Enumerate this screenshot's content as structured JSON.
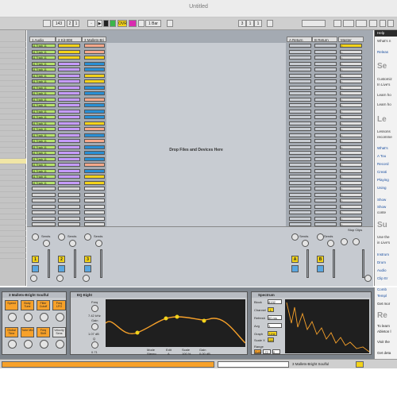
{
  "window": {
    "title": "Untitled"
  },
  "toolbar": {
    "tempo": "143",
    "sig_num": "2",
    "sig_den": "1",
    "ovr": "OVR",
    "quantize": "1 Bar",
    "pos_bars": "3",
    "pos_beats": "1",
    "pos_sixteenths": "1"
  },
  "tracks": [
    {
      "name": "1 Audio",
      "color": "#e0e0e0"
    },
    {
      "name": "2 Kit-808",
      "color": "#e0e0e0"
    },
    {
      "name": "3 Mallets-Bri",
      "color": "#e0e0e0"
    }
  ],
  "returns": [
    {
      "name": "A Return",
      "color": "#e0e0e0"
    },
    {
      "name": "B Return",
      "color": "#e0e0e0"
    }
  ],
  "master": {
    "name": "Master"
  },
  "clip_label": "11 Track 11",
  "drop_text": "Drop Files and Devices Here",
  "mixer": {
    "sends_label": "Sends",
    "stop_clips": "Stop Clips",
    "track_numbers": [
      "1",
      "2",
      "3"
    ],
    "return_letters": [
      "A",
      "B"
    ]
  },
  "help": {
    "header": "Help",
    "line1": "What's n",
    "link1": "Releas",
    "sec1": "Se",
    "p1": "Customiz",
    "p2": "In Live's",
    "p3": "Learn ho",
    "p4": "Learn ho",
    "sec2": "Le",
    "p5": "Lessons",
    "p6": "recomme",
    "links": [
      "What's",
      "A Tou",
      "Record",
      "Creati",
      "Playing",
      "Using"
    ],
    "show1": "Show",
    "show2": "Show",
    "show3": "conte",
    "sec3": "Su",
    "p7": "Use the",
    "p8": "in Live's",
    "links2": [
      "Instrum",
      "Drum",
      "Audio",
      "Clip Er",
      "Comb",
      "Templ"
    ],
    "p9": "Get mor",
    "sec4": "Re",
    "p10": "To learn",
    "p11": "Ableton l",
    "p12": "Visit the",
    "p13": "Get deta"
  },
  "devices": {
    "rack_name": "3 Mallets-Bright Soulful",
    "macros": [
      "Speed",
      "Body Tune",
      "Filter Cutoff",
      "Freq LFO",
      "Global Time",
      "Tube Mix",
      "Freq Shift",
      "Velocity Sens"
    ],
    "eq_name": "EQ Eight",
    "eq_freq": "Freq",
    "eq_freq_val": "7.42 kHz",
    "eq_gain": "Gain",
    "eq_gain_val": "1.07 dB",
    "eq_q": "Q",
    "eq_q_val": "0.71",
    "eq_mode": "Mode",
    "eq_mode_val": "Stereo",
    "eq_edit": "Edit",
    "eq_edit_val": "A",
    "eq_scale": "Scale",
    "eq_scale_val": "100 %",
    "eq_gain2": "Gain",
    "eq_gain2_val": "0.00 dB",
    "spec_name": "Spectrum",
    "spec_block": "Block",
    "spec_block_val": "8192",
    "spec_channel": "Channel",
    "spec_channel_val": "L",
    "spec_refresh": "Refresh",
    "spec_refresh_val": "60 ms",
    "spec_avg": "Avg",
    "spec_avg_val": "1",
    "spec_graph": "Graph",
    "spec_graph_val": "Line",
    "spec_scalex": "Scale X",
    "spec_scalex_val": "Lin",
    "spec_range": "Range",
    "spec_auto": "Auto",
    "spec_range_lo": "-72",
    "spec_range_hi": "0"
  },
  "statusbar": {
    "right_label": "3 Mallets-Bright Soulful"
  }
}
